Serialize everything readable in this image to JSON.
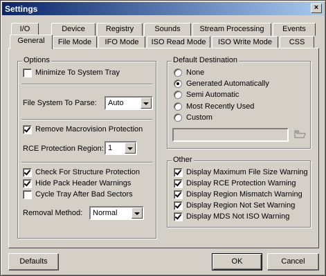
{
  "window": {
    "title": "Settings",
    "close_glyph": "×"
  },
  "tabs_row1": [
    {
      "label": "I/O"
    },
    {
      "label": "Device"
    },
    {
      "label": "Registry"
    },
    {
      "label": "Sounds"
    },
    {
      "label": "Stream Processing"
    },
    {
      "label": "Events"
    }
  ],
  "tabs_row2": [
    {
      "label": "General",
      "active": true
    },
    {
      "label": "File Mode"
    },
    {
      "label": "IFO Mode"
    },
    {
      "label": "ISO Read Mode"
    },
    {
      "label": "ISO Write Mode"
    },
    {
      "label": "CSS"
    }
  ],
  "options": {
    "title": "Options",
    "minimize_to_tray": {
      "label": "Minimize To System Tray",
      "checked": false
    },
    "file_system_label": "File System To Parse:",
    "file_system_value": "Auto",
    "remove_macrovision": {
      "label": "Remove Macrovision Protection",
      "checked": true
    },
    "rce_region_label": "RCE Protection Region:",
    "rce_region_value": "1",
    "check_structure": {
      "label": "Check For Structure Protection",
      "checked": true
    },
    "hide_pack_header": {
      "label": "Hide Pack Header Warnings",
      "checked": true
    },
    "cycle_tray": {
      "label": "Cycle Tray After Bad Sectors",
      "checked": false
    },
    "removal_method_label": "Removal Method:",
    "removal_method_value": "Normal"
  },
  "default_destination": {
    "title": "Default Destination",
    "radios": [
      {
        "label": "None",
        "checked": false
      },
      {
        "label": "Generated Automatically",
        "checked": true
      },
      {
        "label": "Semi Automatic",
        "checked": false
      },
      {
        "label": "Most Recently Used",
        "checked": false
      },
      {
        "label": "Custom",
        "checked": false
      }
    ],
    "custom_path_value": ""
  },
  "other": {
    "title": "Other",
    "checks": [
      {
        "label": "Display Maximum File Size Warning",
        "checked": true
      },
      {
        "label": "Display RCE Protection Warning",
        "checked": true
      },
      {
        "label": "Display Region Mismatch Warning",
        "checked": true
      },
      {
        "label": "Display Region Not Set Warning",
        "checked": true
      },
      {
        "label": "Display MDS Not ISO Warning",
        "checked": true
      }
    ]
  },
  "buttons": {
    "defaults": "Defaults",
    "ok": "OK",
    "cancel": "Cancel"
  },
  "colors": {
    "titlebar_start": "#0a246a",
    "titlebar_end": "#a6caf0",
    "face": "#d4d0c8"
  }
}
